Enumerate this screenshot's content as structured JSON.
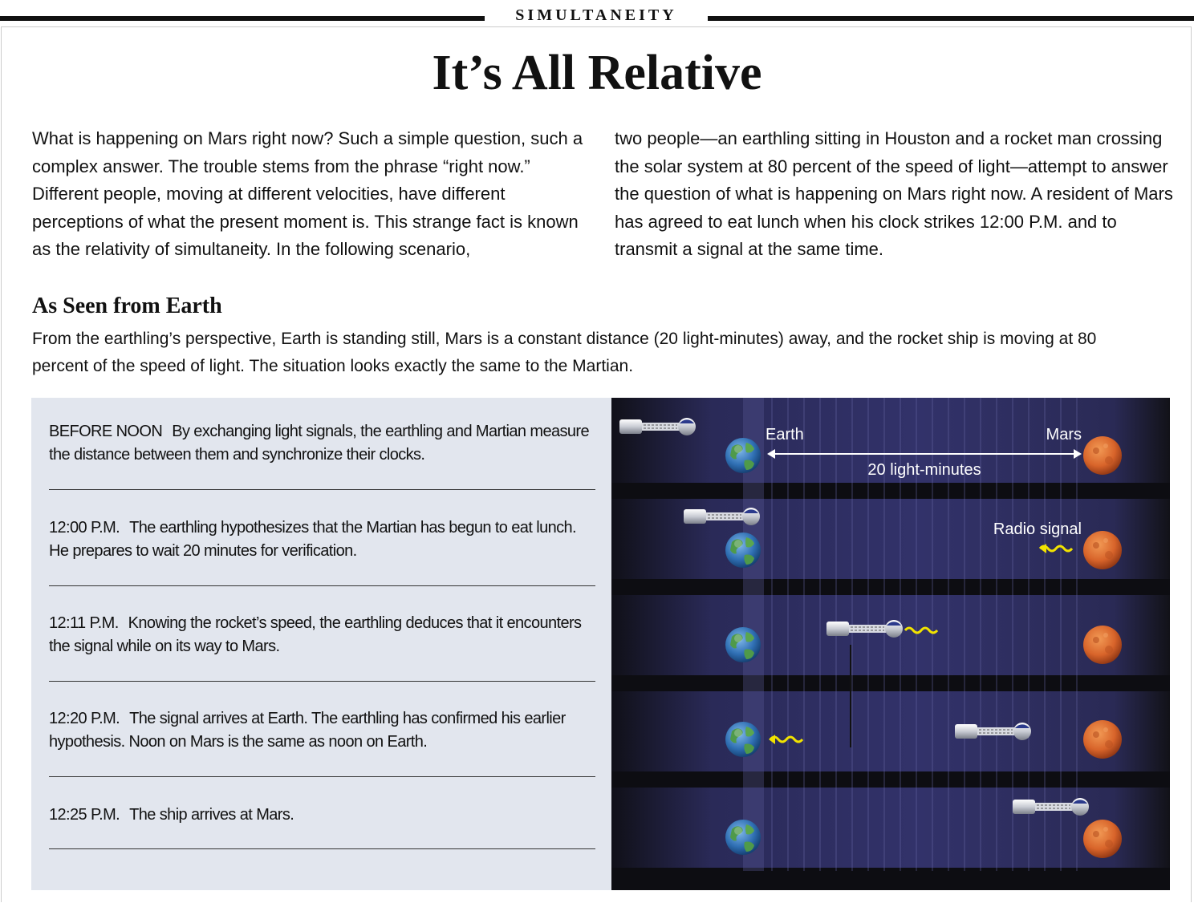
{
  "header": {
    "kicker": "SIMULTANEITY",
    "title": "It’s All Relative"
  },
  "intro": {
    "left": "What is happening on Mars right now? Such a simple question, such a complex answer. The trouble stems from the phrase “right now.” Different people, moving at different velocities, have different perceptions of what the present moment is. This strange fact is known as the relativity of simultaneity. In the following scenario,",
    "right": "two people—an earthling sitting in Houston and a rocket man crossing the solar system at 80 percent of the speed of light—attempt to answer the question of what is happening on Mars right now. A resident of Mars has agreed to eat lunch when his clock strikes 12:00 P.M. and to transmit a signal at the same time."
  },
  "section": {
    "heading": "As Seen from Earth",
    "description": "From the earthling’s perspective, Earth is standing still, Mars is a constant distance (20 light-minutes) away, and the rocket ship is moving at 80 percent of the speed of light. The situation looks exactly the same to the Martian."
  },
  "steps": [
    {
      "time": "BEFORE NOON",
      "text": "By exchanging light signals, the earthling and Martian measure the distance between them and synchronize their clocks."
    },
    {
      "time": "12:00 P.M.",
      "text": "The earthling hypothesizes that the Martian has begun to eat lunch. He prepares to wait 20 minutes for verification."
    },
    {
      "time": "12:11 P.M.",
      "text": "Knowing the rocket’s speed, the earthling deduces that it encounters the signal while on its way to Mars."
    },
    {
      "time": "12:20 P.M.",
      "text": "The signal arrives at Earth. The earthling has confirmed his earlier hypothesis. Noon on Mars is the same as noon on Earth."
    },
    {
      "time": "12:25 P.M.",
      "text": "The ship arrives at Mars."
    }
  ],
  "diagram": {
    "earth_label": "Earth",
    "mars_label": "Mars",
    "distance_label": "20 light-minutes",
    "signal_label": "Radio signal",
    "colors": {
      "space": "#2a2a55",
      "earth_ocean": "#2f6fb3",
      "earth_land": "#4f9a4a",
      "mars": "#d8642a",
      "signal": "#f2e300"
    }
  }
}
